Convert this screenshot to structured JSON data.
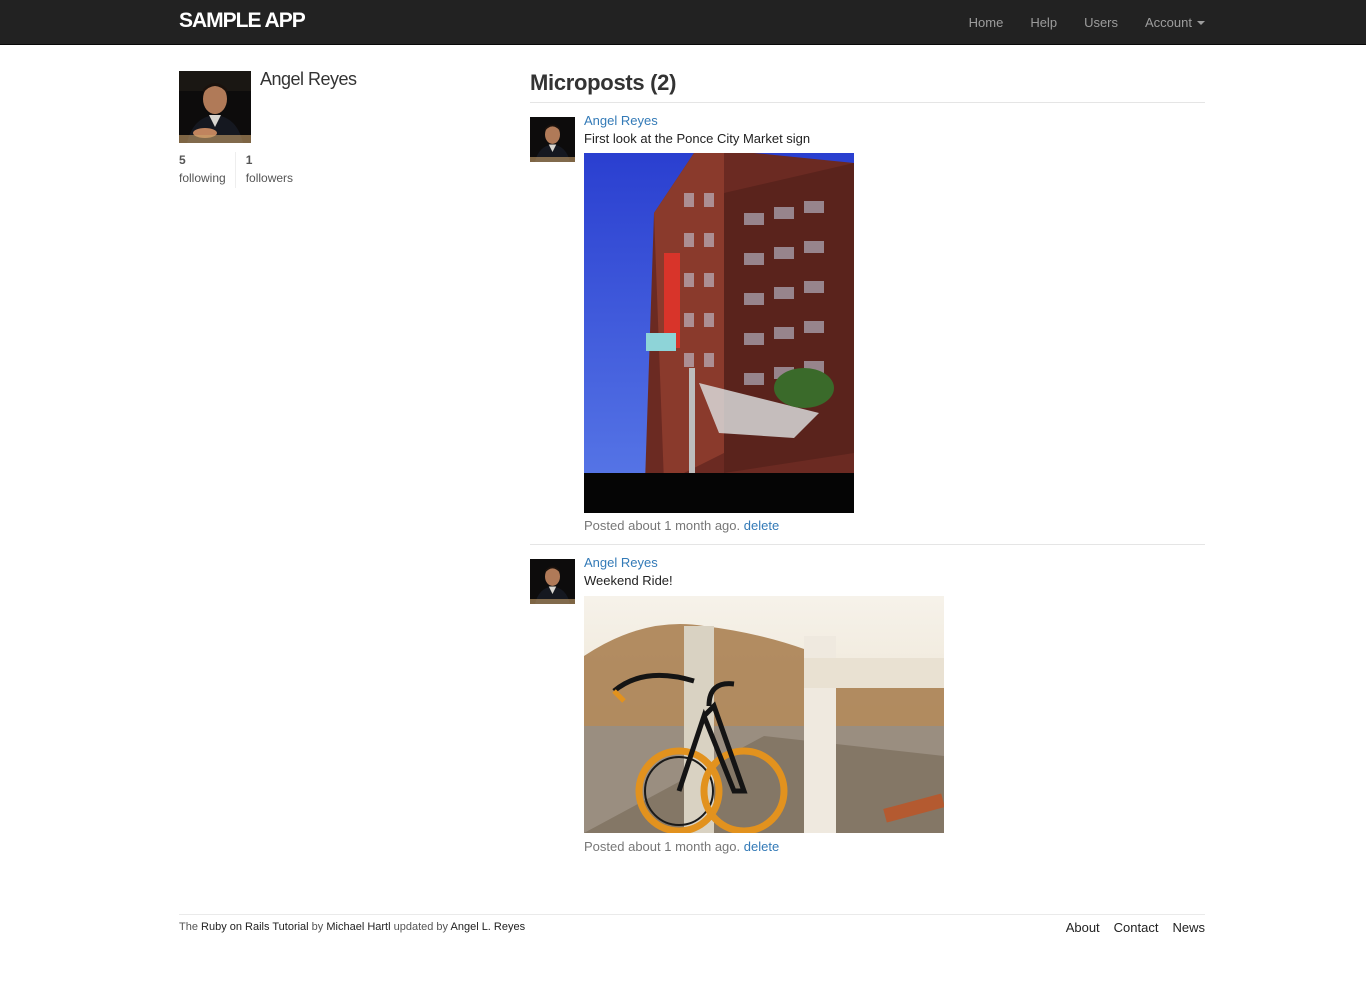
{
  "header": {
    "logo": "SAMPLE APP",
    "nav": {
      "home": "Home",
      "help": "Help",
      "users": "Users",
      "account": "Account"
    }
  },
  "profile": {
    "name": "Angel Reyes",
    "following_count": "5",
    "following_label": "following",
    "followers_count": "1",
    "followers_label": "followers"
  },
  "microposts": {
    "title": "Microposts (2)",
    "items": [
      {
        "user": "Angel Reyes",
        "content": "First look at the Ponce City Market sign",
        "time": "Posted about 1 month ago.",
        "delete": "delete",
        "image_alt": "Ponce City Market building"
      },
      {
        "user": "Angel Reyes",
        "content": "Weekend Ride!",
        "time": "Posted about 1 month ago.",
        "delete": "delete",
        "image_alt": "Fixed-gear bicycle by a fence"
      }
    ]
  },
  "footer": {
    "text1": "The ",
    "link1": "Ruby on Rails Tutorial",
    "text2": " by ",
    "link2": "Michael Hartl",
    "text3": " updated by ",
    "link3": "Angel L. Reyes",
    "links": {
      "about": "About",
      "contact": "Contact",
      "news": "News"
    }
  },
  "colors": {
    "navbar": "#222222",
    "link": "#337ab7",
    "nav_text": "#9d9d9d"
  }
}
